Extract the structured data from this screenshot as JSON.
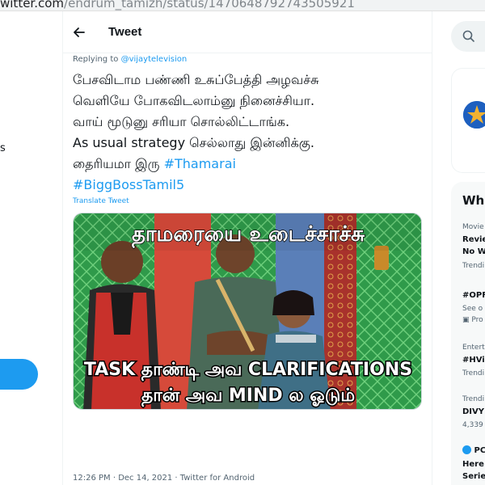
{
  "browser": {
    "url_host": "witter.com",
    "url_path": "/endrum_tamizh/status/1470648792743505921"
  },
  "left_sidebar": {
    "fragment_text": "s"
  },
  "header": {
    "title": "Tweet"
  },
  "tweet": {
    "replying_prefix": "Replying to ",
    "replying_handle": "@vijaytelevision",
    "lines": [
      "பேசவிடாம பண்ணி உசுப்பேத்தி அழவச்சு",
      "வெளியே போகவிடலாம்னு நினைச்சியா."
    ],
    "line3": "வாய் மூடுனு சரியா சொல்லிட்டாங்க.",
    "line4": "As usual strategy செல்லாது இன்னிக்கு.",
    "line5_prefix": "தைரியமா இரு ",
    "line5_hashtag": "#Thamarai",
    "hashtag2": "#BiggBossTamil5",
    "translate": "Translate Tweet",
    "meme": {
      "top_caption": "தாமரையை உடைச்சாச்சு",
      "bottom_line1": "TASK தாண்டி அவ CLARIFICATIONS",
      "bottom_line2": "தான் அவ MIND ல ஓடும்"
    },
    "meta": "12:26 PM · Dec 14, 2021 · Twitter for Android"
  },
  "right_sidebar": {
    "trends_heading": "Wha",
    "trends": [
      {
        "category": "Movie",
        "name1": "Revie",
        "name2": "No W",
        "sub": "Trendi"
      },
      {
        "name": "#OPF",
        "sub1": "See o",
        "sub2": "Pro"
      },
      {
        "category": "Entert",
        "name": "#HVi",
        "sub": "Trendi"
      },
      {
        "category": "Trendi",
        "name": "DIVY",
        "sub": "4,339"
      },
      {
        "badge": "PC",
        "name1": "Here",
        "name2": "Serie"
      }
    ]
  },
  "colors": {
    "accent": "#1d9bf0",
    "text": "#0f1419",
    "secondary": "#536471"
  }
}
